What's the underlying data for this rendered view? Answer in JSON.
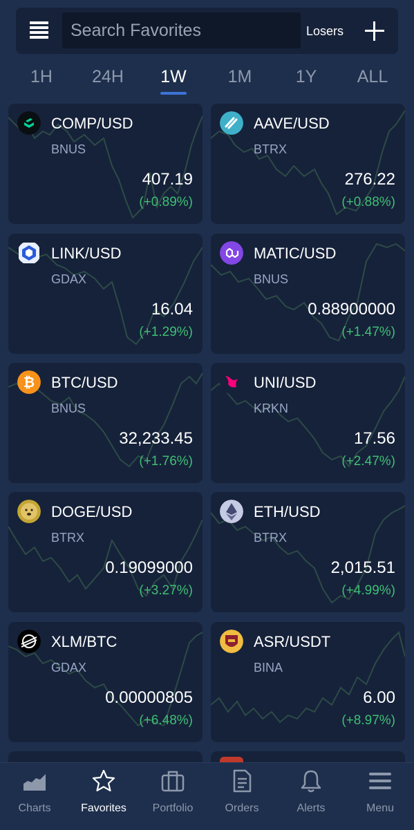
{
  "search": {
    "placeholder": "Search Favorites",
    "filter_label": "Losers"
  },
  "tabs": [
    "1H",
    "24H",
    "1W",
    "1M",
    "1Y",
    "ALL"
  ],
  "active_tab": "1W",
  "colors": {
    "background": "#1e2f4d",
    "card": "#16223a",
    "positive": "#3fbf74",
    "accent": "#3d73d6",
    "sparkline": "#2d4b46"
  },
  "cards": [
    {
      "pair": "COMP/USD",
      "exchange": "BNUS",
      "price": "407.19",
      "change": "(+0.89%)",
      "icon": "compound-icon"
    },
    {
      "pair": "AAVE/USD",
      "exchange": "BTRX",
      "price": "276.22",
      "change": "(+0.88%)",
      "icon": "aave-icon"
    },
    {
      "pair": "LINK/USD",
      "exchange": "GDAX",
      "price": "16.04",
      "change": "(+1.29%)",
      "icon": "chainlink-icon"
    },
    {
      "pair": "MATIC/USD",
      "exchange": "BNUS",
      "price": "0.88900000",
      "change": "(+1.47%)",
      "icon": "polygon-icon"
    },
    {
      "pair": "BTC/USD",
      "exchange": "BNUS",
      "price": "32,233.45",
      "change": "(+1.76%)",
      "icon": "bitcoin-icon"
    },
    {
      "pair": "UNI/USD",
      "exchange": "KRKN",
      "price": "17.56",
      "change": "(+2.47%)",
      "icon": "uniswap-icon"
    },
    {
      "pair": "DOGE/USD",
      "exchange": "BTRX",
      "price": "0.19099000",
      "change": "(+3.27%)",
      "icon": "dogecoin-icon"
    },
    {
      "pair": "ETH/USD",
      "exchange": "BTRX",
      "price": "2,015.51",
      "change": "(+4.99%)",
      "icon": "ethereum-icon"
    },
    {
      "pair": "XLM/BTC",
      "exchange": "GDAX",
      "price": "0.00000805",
      "change": "(+6.48%)",
      "icon": "stellar-icon"
    },
    {
      "pair": "ASR/USDT",
      "exchange": "BINA",
      "price": "6.00",
      "change": "(+8.97%)",
      "icon": "as-roma-icon"
    }
  ],
  "nav": [
    {
      "label": "Charts",
      "icon": "charts-icon"
    },
    {
      "label": "Favorites",
      "icon": "star-icon"
    },
    {
      "label": "Portfolio",
      "icon": "briefcase-icon"
    },
    {
      "label": "Orders",
      "icon": "document-icon"
    },
    {
      "label": "Alerts",
      "icon": "bell-icon"
    },
    {
      "label": "Menu",
      "icon": "menu-icon"
    }
  ],
  "active_nav": "Favorites"
}
